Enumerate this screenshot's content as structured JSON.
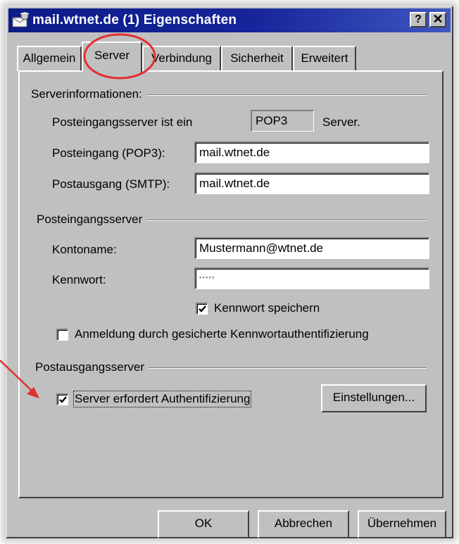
{
  "window": {
    "title": "mail.wtnet.de (1) Eigenschaften",
    "help_button": "?",
    "close_button": "✕",
    "app_icon": "mail-account-icon"
  },
  "tabs": [
    {
      "label": "Allgemein",
      "active": false
    },
    {
      "label": "Server",
      "active": true
    },
    {
      "label": "Verbindung",
      "active": false
    },
    {
      "label": "Sicherheit",
      "active": false
    },
    {
      "label": "Erweitert",
      "active": false
    }
  ],
  "server_info": {
    "group_label": "Serverinformationen:",
    "incoming_type_label": "Posteingangsserver ist ein",
    "incoming_type_value": "POP3",
    "incoming_type_suffix": "Server.",
    "incoming_label": "Posteingang (POP3):",
    "incoming_value": "mail.wtnet.de",
    "outgoing_label": "Postausgang (SMTP):",
    "outgoing_value": "mail.wtnet.de"
  },
  "incoming_server": {
    "group_label": "Posteingangsserver",
    "account_label": "Kontoname:",
    "account_value": "Mustermann@wtnet.de",
    "password_label": "Kennwort:",
    "password_value": "*****",
    "save_password_label": "Kennwort speichern",
    "save_password_checked": true,
    "spa_label": "Anmeldung durch gesicherte Kennwortauthentifizierung",
    "spa_checked": false
  },
  "outgoing_server": {
    "group_label": "Postausgangsserver",
    "auth_label": "Server erfordert Authentifizierung",
    "auth_checked": true,
    "settings_button": "Einstellungen..."
  },
  "footer": {
    "ok": "OK",
    "cancel": "Abbrechen",
    "apply": "Übernehmen"
  },
  "annotations": {
    "highlight_color": "#e03030"
  }
}
